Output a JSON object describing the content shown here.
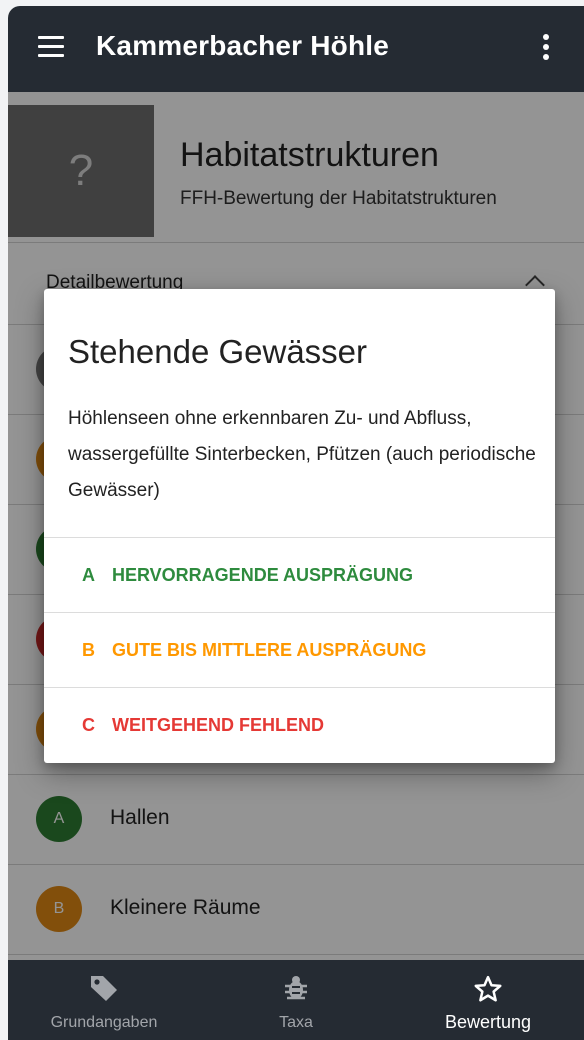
{
  "appbar": {
    "title": "Kammerbacher Höhle",
    "menu_icon": "hamburger-menu-icon",
    "more_icon": "more-vertical-icon"
  },
  "header": {
    "image_placeholder": "?",
    "title": "Habitatstrukturen",
    "subtitle": "FFH-Bewertung der Habitatstrukturen"
  },
  "detail": {
    "label": "Detailbewertung",
    "chevron_icon": "chevron-up-icon"
  },
  "list": {
    "items": [
      {
        "grade": "A",
        "label": "Hallen",
        "color": "#2e7d32"
      },
      {
        "grade": "B",
        "label": "Kleinere Räume",
        "color": "#e08914"
      }
    ],
    "hidden_avatar_colors": [
      "#757575",
      "#e08914",
      "#2e7d32",
      "#c62828",
      "#e08914"
    ]
  },
  "dialog": {
    "title": "Stehende Gewässer",
    "text": "Höhlenseen ohne erkennbaren Zu- und Abfluss, wassergefüllte Sinterbecken, Pfützen (auch periodische Gewässer)",
    "options": [
      {
        "letter": "A",
        "label": "HERVORRAGENDE AUSPRÄGUNG",
        "color": "#2e8b3e"
      },
      {
        "letter": "B",
        "label": "GUTE BIS MITTLERE AUSPRÄGUNG",
        "color": "#ff9800"
      },
      {
        "letter": "C",
        "label": "WEITGEHEND FEHLEND",
        "color": "#e53935"
      }
    ]
  },
  "bottomnav": {
    "items": [
      {
        "label": "Grundangaben",
        "icon": "tag-icon",
        "active": false
      },
      {
        "label": "Taxa",
        "icon": "bug-icon",
        "active": false
      },
      {
        "label": "Bewertung",
        "icon": "star-outline-icon",
        "active": true
      }
    ]
  },
  "colors": {
    "appbar": "#252b33",
    "scrim": "rgba(0,0,0,0.42)"
  }
}
